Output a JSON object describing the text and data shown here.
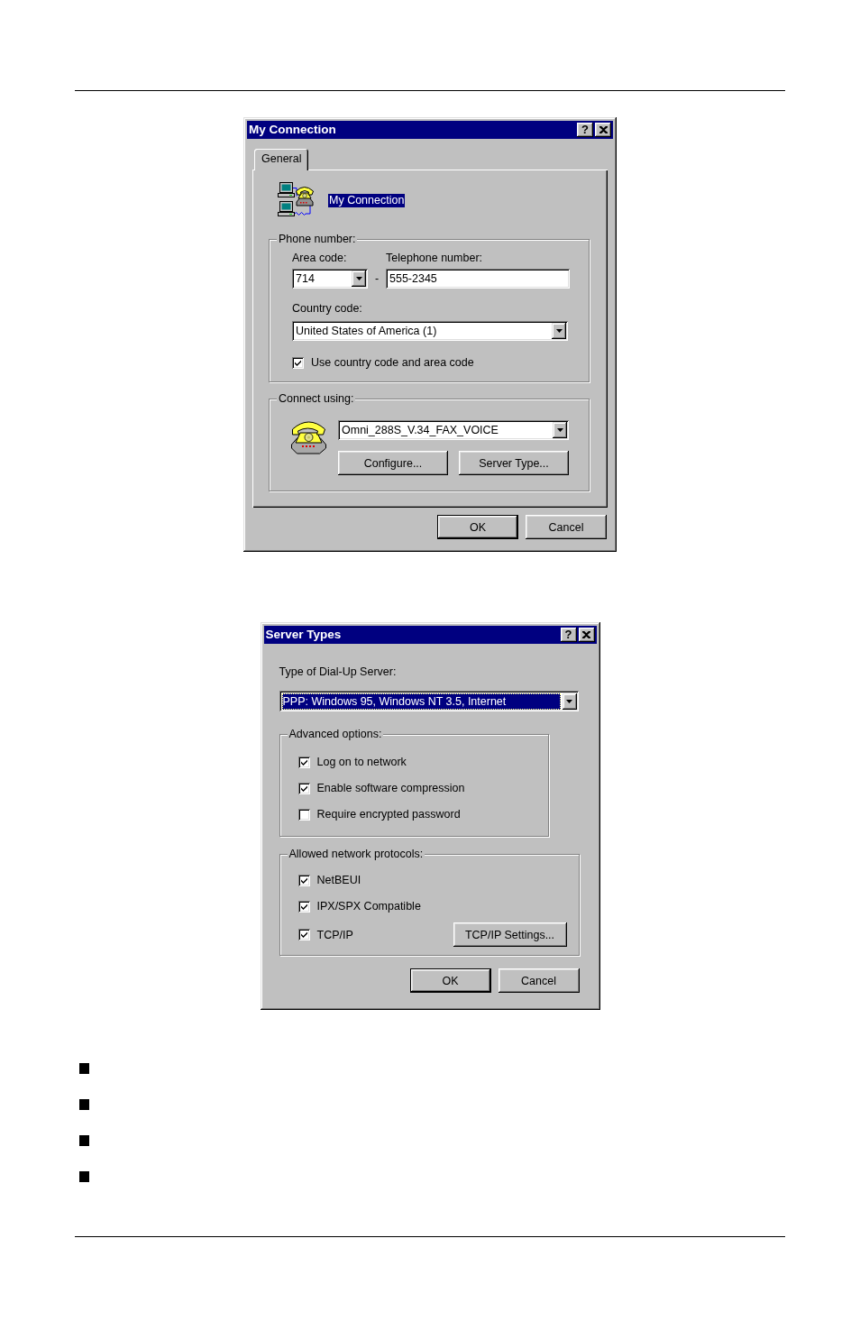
{
  "connection_dialog": {
    "title": "My Connection",
    "help_button": "?",
    "tabs": [
      {
        "label": "General",
        "selected": true
      }
    ],
    "connection_name": {
      "text": "My Connection",
      "highlighted": true
    },
    "phone_number": {
      "label": "Phone number:",
      "area_code": {
        "label": "Area code:",
        "value": "714"
      },
      "separator": "-",
      "telephone": {
        "label": "Telephone number:",
        "value": "555-2345"
      },
      "country_code": {
        "label": "Country code:",
        "value": "United States of America (1)"
      },
      "use_codes": {
        "label": "Use country code and area code",
        "checked": true
      }
    },
    "connect_using": {
      "label": "Connect using:",
      "device": "Omni_288S_V.34_FAX_VOICE",
      "buttons": [
        "Configure...",
        "Server Type..."
      ]
    },
    "buttons": [
      {
        "label": "OK",
        "is_default": true
      },
      {
        "label": "Cancel",
        "is_default": false
      }
    ]
  },
  "server_types_dialog": {
    "title": "Server Types",
    "help_button": "?",
    "server_type": {
      "label": "Type of Dial-Up Server:",
      "value": "PPP: Windows 95, Windows NT 3.5, Internet",
      "selected": true
    },
    "advanced_options": {
      "label": "Advanced options:",
      "options": [
        {
          "label": "Log on to network",
          "checked": true
        },
        {
          "label": "Enable software compression",
          "checked": true
        },
        {
          "label": "Require encrypted password",
          "checked": false
        }
      ]
    },
    "protocols": {
      "label": "Allowed network protocols:",
      "options": [
        {
          "label": "NetBEUI",
          "checked": true
        },
        {
          "label": "IPX/SPX Compatible",
          "checked": true
        },
        {
          "label": "TCP/IP",
          "checked": true,
          "button": "TCP/IP Settings..."
        }
      ]
    },
    "buttons": [
      {
        "label": "OK",
        "is_default": true
      },
      {
        "label": "Cancel",
        "is_default": false
      }
    ]
  }
}
